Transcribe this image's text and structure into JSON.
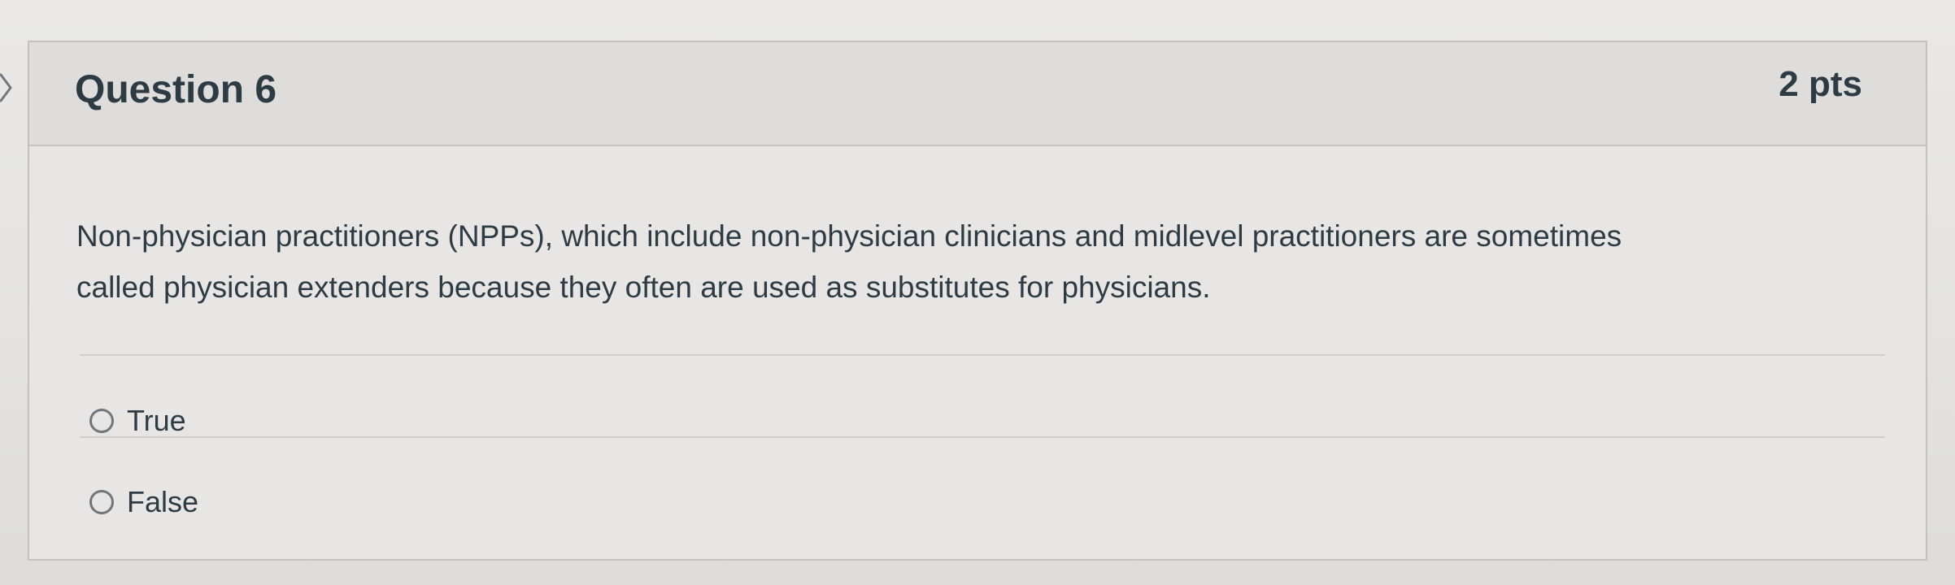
{
  "question": {
    "title": "Question 6",
    "points": "2 pts",
    "text_lines": [
      "Non-physician practitioners (NPPs), which include non-physician clinicians and midlevel practitioners are sometimes",
      "called physician extenders because they often are used as substitutes for physicians."
    ],
    "answers": [
      {
        "label": "True",
        "selected": false
      },
      {
        "label": "False",
        "selected": false
      }
    ]
  },
  "icons": {
    "edge_chevron": "chevron-right-icon",
    "radio": "radio-button-unselected-icon"
  },
  "colors": {
    "text": "#2d3b45",
    "header_background": "#dedddb",
    "card_background": "#e7e6e4",
    "border": "#c3c2c0",
    "radio_border": "#6f767c"
  }
}
